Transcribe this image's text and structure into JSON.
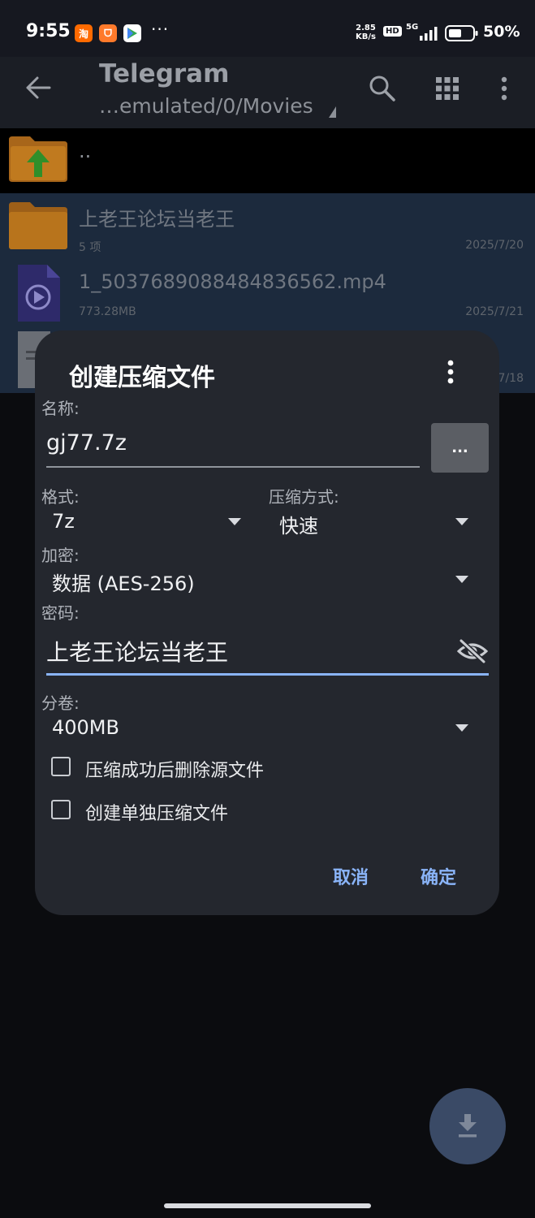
{
  "status_bar": {
    "time": "9:55",
    "app_icons": [
      {
        "icon": "taobao-icon",
        "glyph": "淘",
        "color": "#ff6a00"
      },
      {
        "icon": "shopping-bag-icon",
        "glyph": "ᗜ",
        "color": "#ff7a2b"
      },
      {
        "icon": "play-store-icon",
        "glyph": "▶",
        "color": "#ffffff"
      }
    ],
    "more": "···",
    "net_speed_value": "2.85",
    "net_speed_unit": "KB/s",
    "hd": "HD",
    "network": "5G",
    "battery": "50%"
  },
  "app_bar": {
    "title": "Telegram",
    "path": "…emulated/0/Movies"
  },
  "file_list": {
    "parent": "..",
    "items": [
      {
        "name": "上老王论坛当老王",
        "meta": "5 项",
        "date": "2025/7/20",
        "type": "folder"
      },
      {
        "name": "1_5037689088484836562.mp4",
        "meta": "773.28MB",
        "date": "2025/7/21",
        "type": "video"
      },
      {
        "name": "",
        "meta": "",
        "date": "7/18",
        "type": "document"
      }
    ]
  },
  "dialog": {
    "title": "创建压缩文件",
    "name_label": "名称:",
    "name_value": "gj77.7z",
    "browse_label": "...",
    "format_label": "格式:",
    "format_value": "7z",
    "compression_label": "压缩方式:",
    "compression_value": "快速",
    "encryption_label": "加密:",
    "encryption_value": "数据 (AES-256)",
    "password_label": "密码:",
    "password_value": "上老王论坛当老王",
    "split_label": "分卷:",
    "split_value": "400MB",
    "option_delete": "压缩成功后删除源文件",
    "option_separate": "创建单独压缩文件",
    "cancel": "取消",
    "ok": "确定"
  },
  "colors": {
    "accent": "#8ab4f8",
    "folder": "#c07a1f",
    "dialog_bg": "#24272e",
    "selection": "#1c2a3d"
  }
}
